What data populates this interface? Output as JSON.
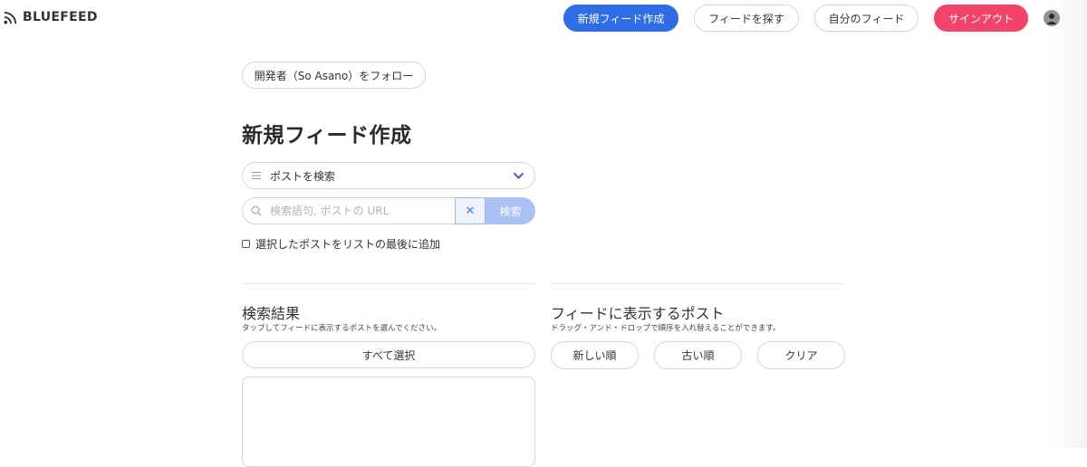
{
  "app": {
    "name": "BLUEFEED"
  },
  "nav": {
    "create_feed": "新規フィード作成",
    "find_feed": "フィードを探す",
    "my_feeds": "自分のフィード",
    "sign_out": "サインアウト"
  },
  "main": {
    "follow_button": "開発者（So Asano）をフォロー",
    "title": "新規フィード作成",
    "mode_select": {
      "value": "ポストを検索"
    },
    "search": {
      "placeholder": "検索語句, ポストの URL",
      "clear_symbol": "✕",
      "button": "検索"
    },
    "append_checkbox": {
      "label": "選択したポストをリストの最後に追加",
      "checked": false
    }
  },
  "results": {
    "title": "検索結果",
    "subtitle": "タップしてフィードに表示するポストを選んでください。",
    "select_all": "すべて選択"
  },
  "feed_posts": {
    "title": "フィードに表示するポスト",
    "subtitle": "ドラッグ・アンド・ドロップで順序を入れ替えることができます。",
    "sort_newest": "新しい順",
    "sort_oldest": "古い順",
    "clear": "クリア"
  },
  "colors": {
    "primary": "#2f6de6",
    "danger": "#f2446b",
    "search_disabled": "#a9c2f3"
  }
}
